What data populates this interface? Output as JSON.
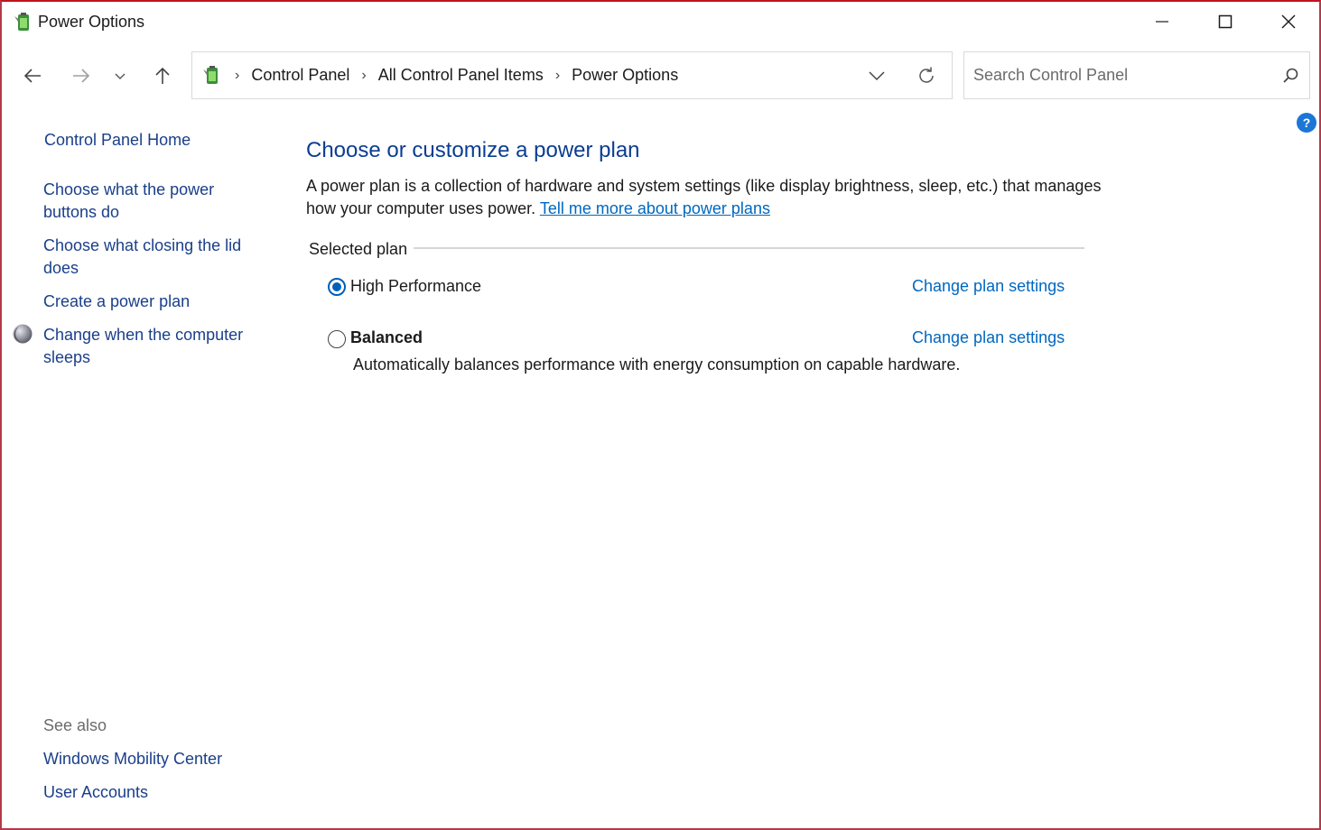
{
  "window": {
    "title": "Power Options"
  },
  "nav": {
    "breadcrumbs": [
      "Control Panel",
      "All Control Panel Items",
      "Power Options"
    ],
    "search_placeholder": "Search Control Panel"
  },
  "sidebar": {
    "home": "Control Panel Home",
    "links": [
      "Choose what the power buttons do",
      "Choose what closing the lid does",
      "Create a power plan",
      "Change when the computer sleeps"
    ],
    "see_also_label": "See also",
    "see_also": [
      "Windows Mobility Center",
      "User Accounts"
    ]
  },
  "main": {
    "title": "Choose or customize a power plan",
    "description": "A power plan is a collection of hardware and system settings (like display brightness, sleep, etc.) that manages how your computer uses power.",
    "learn_more": "Tell me more about power plans",
    "group_label": "Selected plan",
    "plans": [
      {
        "name": "High Performance",
        "selected": true,
        "link": "Change plan settings",
        "description": ""
      },
      {
        "name": "Balanced",
        "selected": false,
        "link": "Change plan settings",
        "description": "Automatically balances performance with energy consumption on capable hardware."
      }
    ]
  },
  "icons": {
    "help": "?"
  },
  "colors": {
    "title_blue": "#0b3d91",
    "link_blue": "#0067c0",
    "radio_blue": "#005fb8",
    "window_border": "#c1121f"
  }
}
